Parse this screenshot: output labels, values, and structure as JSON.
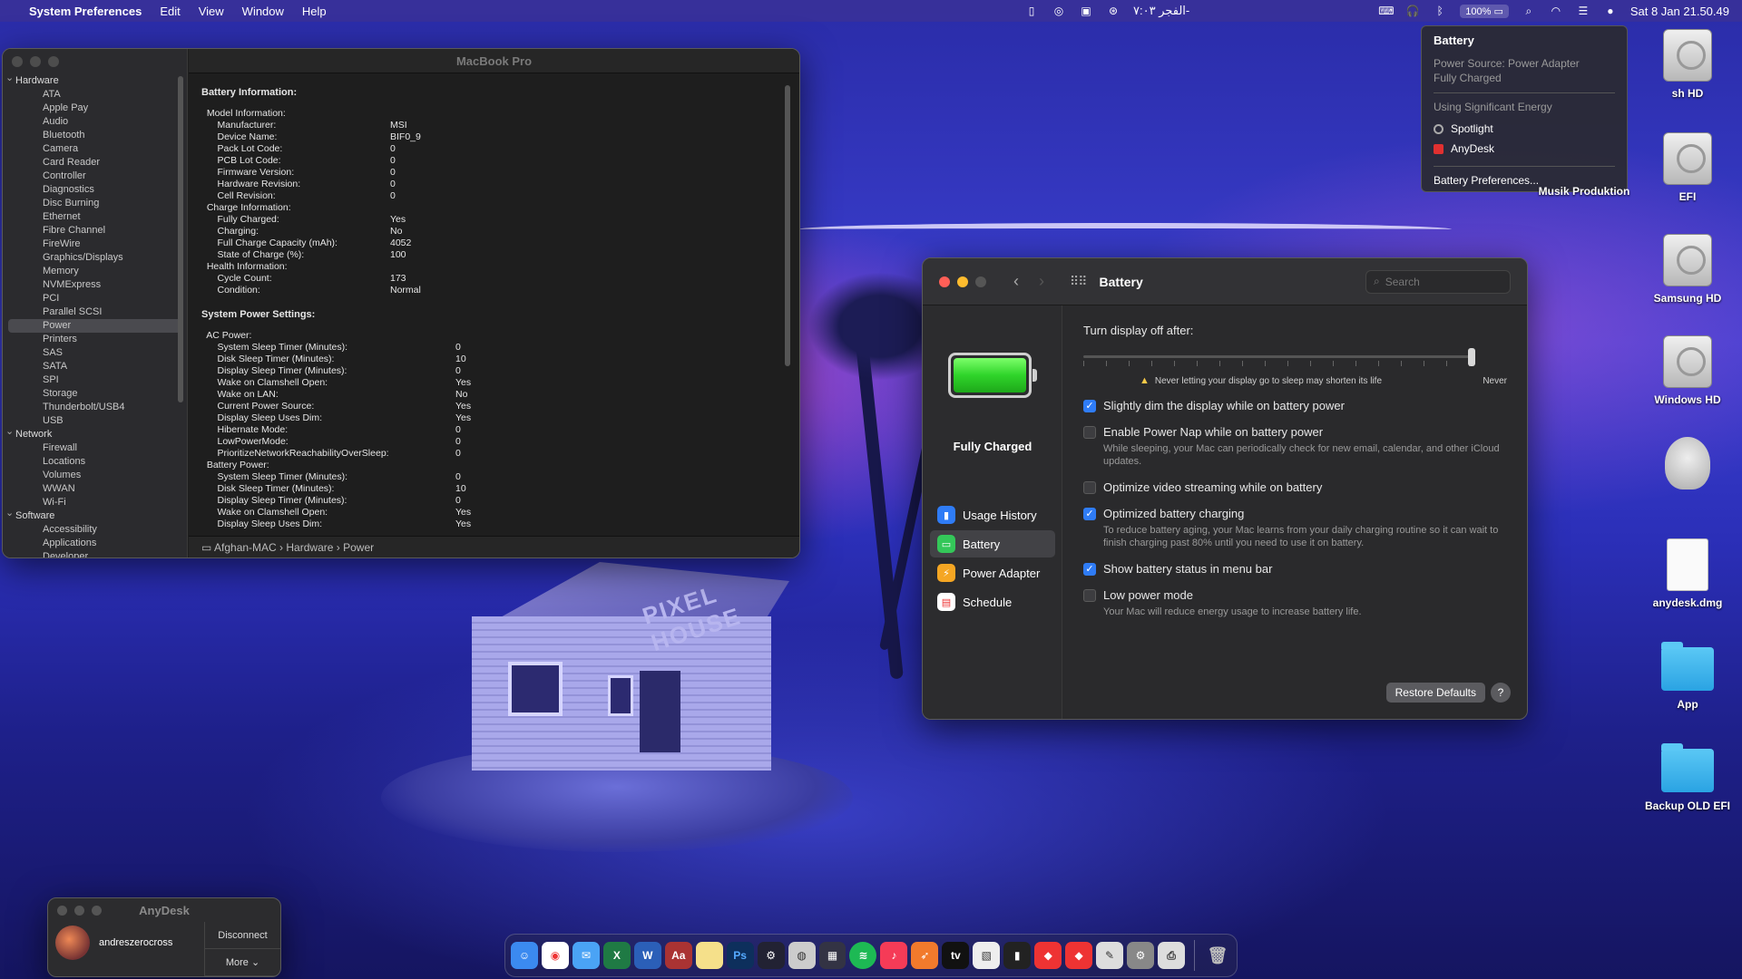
{
  "menubar": {
    "app_name": "System Preferences",
    "menus": [
      "Edit",
      "View",
      "Window",
      "Help"
    ],
    "prayer": "الفجر ٧:٠٣-",
    "battery_percent": "100%",
    "datetime": "Sat 8 Jan  21.50.49"
  },
  "battery_menu": {
    "title": "Battery",
    "source": "Power Source: Power Adapter",
    "state": "Fully Charged",
    "energy_header": "Using Significant Energy",
    "apps": [
      "Spotlight",
      "AnyDesk"
    ],
    "prefs_link": "Battery Preferences..."
  },
  "desktop": {
    "icons": [
      "sh HD",
      "EFI",
      "Musik Produktion",
      "Samsung HD",
      "Windows HD",
      "anydesk.dmg",
      "App",
      "Backup OLD EFI"
    ]
  },
  "sysinfo": {
    "title": "MacBook Pro",
    "tree": [
      {
        "type": "grp",
        "label": "Hardware"
      },
      {
        "type": "itm",
        "label": "ATA"
      },
      {
        "type": "itm",
        "label": "Apple Pay"
      },
      {
        "type": "itm",
        "label": "Audio"
      },
      {
        "type": "itm",
        "label": "Bluetooth"
      },
      {
        "type": "itm",
        "label": "Camera"
      },
      {
        "type": "itm",
        "label": "Card Reader"
      },
      {
        "type": "itm",
        "label": "Controller"
      },
      {
        "type": "itm",
        "label": "Diagnostics"
      },
      {
        "type": "itm",
        "label": "Disc Burning"
      },
      {
        "type": "itm",
        "label": "Ethernet"
      },
      {
        "type": "itm",
        "label": "Fibre Channel"
      },
      {
        "type": "itm",
        "label": "FireWire"
      },
      {
        "type": "itm",
        "label": "Graphics/Displays"
      },
      {
        "type": "itm",
        "label": "Memory"
      },
      {
        "type": "itm",
        "label": "NVMExpress"
      },
      {
        "type": "itm",
        "label": "PCI"
      },
      {
        "type": "itm",
        "label": "Parallel SCSI"
      },
      {
        "type": "itm",
        "label": "Power",
        "selected": true
      },
      {
        "type": "itm",
        "label": "Printers"
      },
      {
        "type": "itm",
        "label": "SAS"
      },
      {
        "type": "itm",
        "label": "SATA"
      },
      {
        "type": "itm",
        "label": "SPI"
      },
      {
        "type": "itm",
        "label": "Storage"
      },
      {
        "type": "itm",
        "label": "Thunderbolt/USB4"
      },
      {
        "type": "itm",
        "label": "USB"
      },
      {
        "type": "grp",
        "label": "Network"
      },
      {
        "type": "itm",
        "label": "Firewall"
      },
      {
        "type": "itm",
        "label": "Locations"
      },
      {
        "type": "itm",
        "label": "Volumes"
      },
      {
        "type": "itm",
        "label": "WWAN"
      },
      {
        "type": "itm",
        "label": "Wi-Fi"
      },
      {
        "type": "grp",
        "label": "Software"
      },
      {
        "type": "itm",
        "label": "Accessibility"
      },
      {
        "type": "itm",
        "label": "Applications"
      },
      {
        "type": "itm",
        "label": "Developer"
      }
    ],
    "heading1": "Battery Information:",
    "battery_lines": [
      [
        "  Model Information:",
        ""
      ],
      [
        "      Manufacturer:",
        "MSI"
      ],
      [
        "      Device Name:",
        "BIF0_9"
      ],
      [
        "      Pack Lot Code:",
        "0"
      ],
      [
        "      PCB Lot Code:",
        "0"
      ],
      [
        "      Firmware Version:",
        "0"
      ],
      [
        "      Hardware Revision:",
        "0"
      ],
      [
        "      Cell Revision:",
        "0"
      ],
      [
        "  Charge Information:",
        ""
      ],
      [
        "      Fully Charged:",
        "Yes"
      ],
      [
        "      Charging:",
        "No"
      ],
      [
        "      Full Charge Capacity (mAh):",
        "4052"
      ],
      [
        "      State of Charge (%):",
        "100"
      ],
      [
        "  Health Information:",
        ""
      ],
      [
        "      Cycle Count:",
        "173"
      ],
      [
        "      Condition:",
        "Normal"
      ]
    ],
    "heading2": "System Power Settings:",
    "power_lines": [
      [
        "  AC Power:",
        ""
      ],
      [
        "      System Sleep Timer (Minutes):",
        "0"
      ],
      [
        "      Disk Sleep Timer (Minutes):",
        "10"
      ],
      [
        "      Display Sleep Timer (Minutes):",
        "0"
      ],
      [
        "      Wake on Clamshell Open:",
        "Yes"
      ],
      [
        "      Wake on LAN:",
        "No"
      ],
      [
        "      Current Power Source:",
        "Yes"
      ],
      [
        "      Display Sleep Uses Dim:",
        "Yes"
      ],
      [
        "      Hibernate Mode:",
        "0"
      ],
      [
        "      LowPowerMode:",
        "0"
      ],
      [
        "      PrioritizeNetworkReachabilityOverSleep:",
        "0"
      ],
      [
        "  Battery Power:",
        ""
      ],
      [
        "      System Sleep Timer (Minutes):",
        "0"
      ],
      [
        "      Disk Sleep Timer (Minutes):",
        "10"
      ],
      [
        "      Display Sleep Timer (Minutes):",
        "0"
      ],
      [
        "      Wake on Clamshell Open:",
        "Yes"
      ],
      [
        "      Display Sleep Uses Dim:",
        "Yes"
      ]
    ],
    "path": [
      "Afghan-MAC",
      "Hardware",
      "Power"
    ]
  },
  "prefs": {
    "title": "Battery",
    "search_placeholder": "Search",
    "status": "Fully Charged",
    "nav": [
      "Usage History",
      "Battery",
      "Power Adapter",
      "Schedule"
    ],
    "turn_off_label": "Turn display off after:",
    "warning": "Never letting your display go to sleep may shorten its life",
    "never_label": "Never",
    "slider_level": 1.0,
    "options": [
      {
        "title": "Slightly dim the display while on battery power",
        "checked": true,
        "desc": ""
      },
      {
        "title": "Enable Power Nap while on battery power",
        "checked": false,
        "desc": "While sleeping, your Mac can periodically check for new email, calendar, and other iCloud updates."
      },
      {
        "title": "Optimize video streaming while on battery",
        "checked": false,
        "desc": ""
      },
      {
        "title": "Optimized battery charging",
        "checked": true,
        "desc": "To reduce battery aging, your Mac learns from your daily charging routine so it can wait to finish charging past 80% until you need to use it on battery."
      },
      {
        "title": "Show battery status in menu bar",
        "checked": true,
        "desc": ""
      },
      {
        "title": "Low power mode",
        "checked": false,
        "desc": "Your Mac will reduce energy usage to increase battery life."
      }
    ],
    "restore_label": "Restore Defaults",
    "help_label": "?"
  },
  "anydesk": {
    "title": "AnyDesk",
    "user": "andreszerocross",
    "disconnect": "Disconnect",
    "more": "More"
  },
  "wallpaper_sign": "PIXEL HOUSE"
}
